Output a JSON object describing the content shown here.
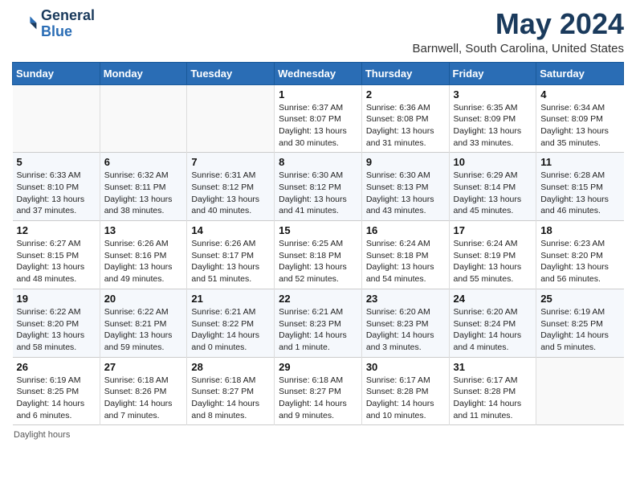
{
  "header": {
    "logo_line1": "General",
    "logo_line2": "Blue",
    "main_title": "May 2024",
    "subtitle": "Barnwell, South Carolina, United States"
  },
  "days_of_week": [
    "Sunday",
    "Monday",
    "Tuesday",
    "Wednesday",
    "Thursday",
    "Friday",
    "Saturday"
  ],
  "weeks": [
    [
      {
        "day": "",
        "content": ""
      },
      {
        "day": "",
        "content": ""
      },
      {
        "day": "",
        "content": ""
      },
      {
        "day": "1",
        "content": "Sunrise: 6:37 AM\nSunset: 8:07 PM\nDaylight: 13 hours and 30 minutes."
      },
      {
        "day": "2",
        "content": "Sunrise: 6:36 AM\nSunset: 8:08 PM\nDaylight: 13 hours and 31 minutes."
      },
      {
        "day": "3",
        "content": "Sunrise: 6:35 AM\nSunset: 8:09 PM\nDaylight: 13 hours and 33 minutes."
      },
      {
        "day": "4",
        "content": "Sunrise: 6:34 AM\nSunset: 8:09 PM\nDaylight: 13 hours and 35 minutes."
      }
    ],
    [
      {
        "day": "5",
        "content": "Sunrise: 6:33 AM\nSunset: 8:10 PM\nDaylight: 13 hours and 37 minutes."
      },
      {
        "day": "6",
        "content": "Sunrise: 6:32 AM\nSunset: 8:11 PM\nDaylight: 13 hours and 38 minutes."
      },
      {
        "day": "7",
        "content": "Sunrise: 6:31 AM\nSunset: 8:12 PM\nDaylight: 13 hours and 40 minutes."
      },
      {
        "day": "8",
        "content": "Sunrise: 6:30 AM\nSunset: 8:12 PM\nDaylight: 13 hours and 41 minutes."
      },
      {
        "day": "9",
        "content": "Sunrise: 6:30 AM\nSunset: 8:13 PM\nDaylight: 13 hours and 43 minutes."
      },
      {
        "day": "10",
        "content": "Sunrise: 6:29 AM\nSunset: 8:14 PM\nDaylight: 13 hours and 45 minutes."
      },
      {
        "day": "11",
        "content": "Sunrise: 6:28 AM\nSunset: 8:15 PM\nDaylight: 13 hours and 46 minutes."
      }
    ],
    [
      {
        "day": "12",
        "content": "Sunrise: 6:27 AM\nSunset: 8:15 PM\nDaylight: 13 hours and 48 minutes."
      },
      {
        "day": "13",
        "content": "Sunrise: 6:26 AM\nSunset: 8:16 PM\nDaylight: 13 hours and 49 minutes."
      },
      {
        "day": "14",
        "content": "Sunrise: 6:26 AM\nSunset: 8:17 PM\nDaylight: 13 hours and 51 minutes."
      },
      {
        "day": "15",
        "content": "Sunrise: 6:25 AM\nSunset: 8:18 PM\nDaylight: 13 hours and 52 minutes."
      },
      {
        "day": "16",
        "content": "Sunrise: 6:24 AM\nSunset: 8:18 PM\nDaylight: 13 hours and 54 minutes."
      },
      {
        "day": "17",
        "content": "Sunrise: 6:24 AM\nSunset: 8:19 PM\nDaylight: 13 hours and 55 minutes."
      },
      {
        "day": "18",
        "content": "Sunrise: 6:23 AM\nSunset: 8:20 PM\nDaylight: 13 hours and 56 minutes."
      }
    ],
    [
      {
        "day": "19",
        "content": "Sunrise: 6:22 AM\nSunset: 8:20 PM\nDaylight: 13 hours and 58 minutes."
      },
      {
        "day": "20",
        "content": "Sunrise: 6:22 AM\nSunset: 8:21 PM\nDaylight: 13 hours and 59 minutes."
      },
      {
        "day": "21",
        "content": "Sunrise: 6:21 AM\nSunset: 8:22 PM\nDaylight: 14 hours and 0 minutes."
      },
      {
        "day": "22",
        "content": "Sunrise: 6:21 AM\nSunset: 8:23 PM\nDaylight: 14 hours and 1 minute."
      },
      {
        "day": "23",
        "content": "Sunrise: 6:20 AM\nSunset: 8:23 PM\nDaylight: 14 hours and 3 minutes."
      },
      {
        "day": "24",
        "content": "Sunrise: 6:20 AM\nSunset: 8:24 PM\nDaylight: 14 hours and 4 minutes."
      },
      {
        "day": "25",
        "content": "Sunrise: 6:19 AM\nSunset: 8:25 PM\nDaylight: 14 hours and 5 minutes."
      }
    ],
    [
      {
        "day": "26",
        "content": "Sunrise: 6:19 AM\nSunset: 8:25 PM\nDaylight: 14 hours and 6 minutes."
      },
      {
        "day": "27",
        "content": "Sunrise: 6:18 AM\nSunset: 8:26 PM\nDaylight: 14 hours and 7 minutes."
      },
      {
        "day": "28",
        "content": "Sunrise: 6:18 AM\nSunset: 8:27 PM\nDaylight: 14 hours and 8 minutes."
      },
      {
        "day": "29",
        "content": "Sunrise: 6:18 AM\nSunset: 8:27 PM\nDaylight: 14 hours and 9 minutes."
      },
      {
        "day": "30",
        "content": "Sunrise: 6:17 AM\nSunset: 8:28 PM\nDaylight: 14 hours and 10 minutes."
      },
      {
        "day": "31",
        "content": "Sunrise: 6:17 AM\nSunset: 8:28 PM\nDaylight: 14 hours and 11 minutes."
      },
      {
        "day": "",
        "content": ""
      }
    ]
  ],
  "footer": {
    "daylight_label": "Daylight hours"
  }
}
